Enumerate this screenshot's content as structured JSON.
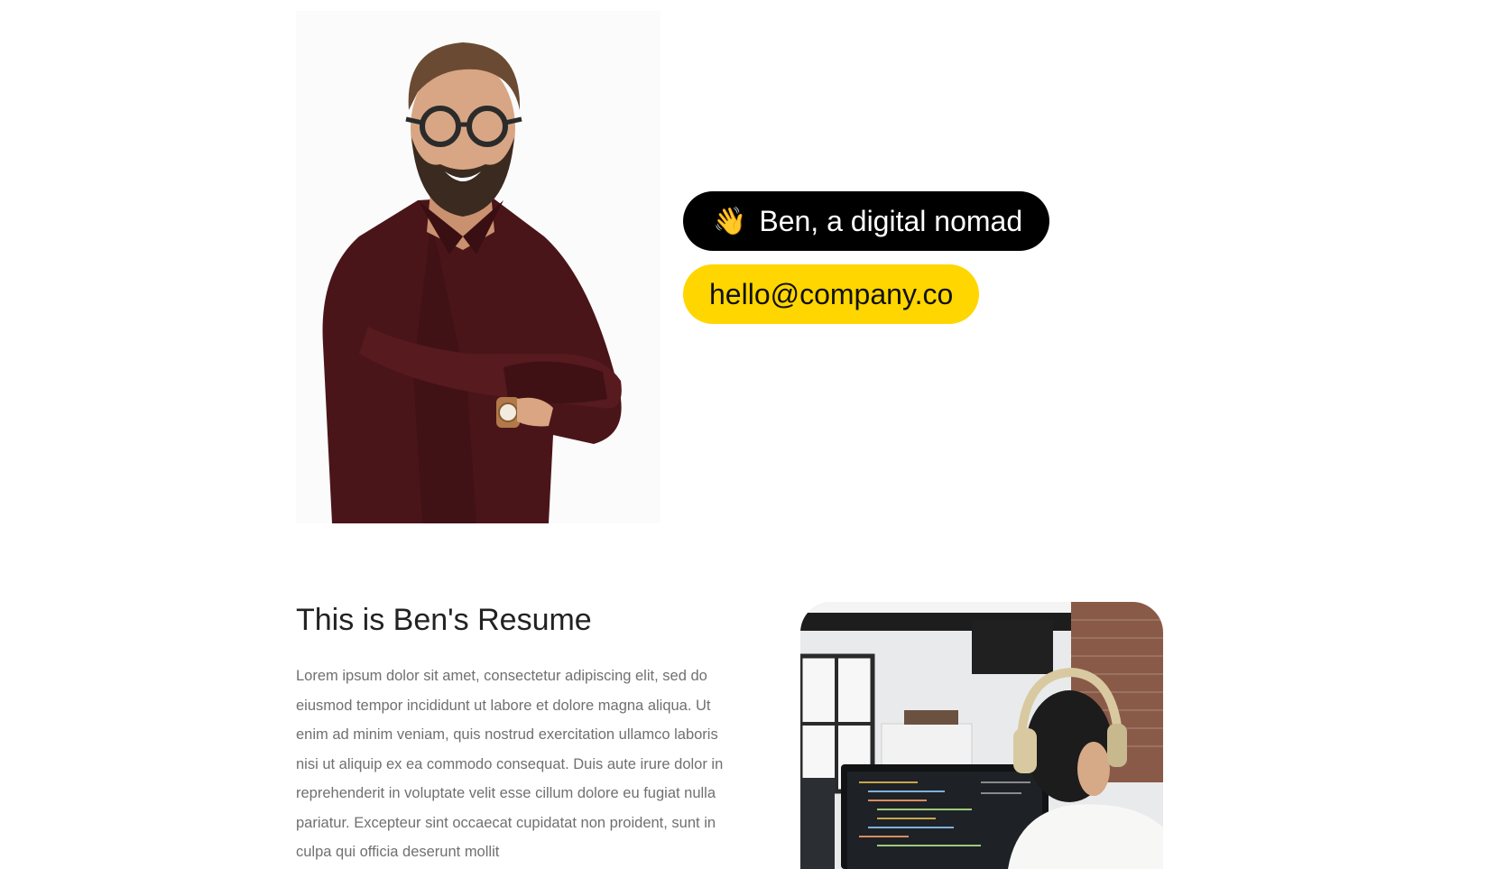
{
  "hero": {
    "name_pill": {
      "emoji": "👋",
      "label": "Ben, a digital nomad",
      "color": "#000000"
    },
    "email_pill": {
      "label": "hello@company.co",
      "color": "#ffd600"
    }
  },
  "resume": {
    "title": "This is Ben's Resume",
    "body": "Lorem ipsum dolor sit amet, consectetur adipiscing elit, sed do eiusmod tempor incididunt ut labore et dolore magna aliqua. Ut enim ad minim veniam, quis nostrud exercitation ullamco laboris nisi ut aliquip ex ea commodo consequat. Duis aute irure dolor in reprehenderit in voluptate velit esse cillum dolore eu fugiat nulla pariatur. Excepteur sint occaecat cupidatat non proident, sunt in culpa qui officia deserunt mollit"
  }
}
